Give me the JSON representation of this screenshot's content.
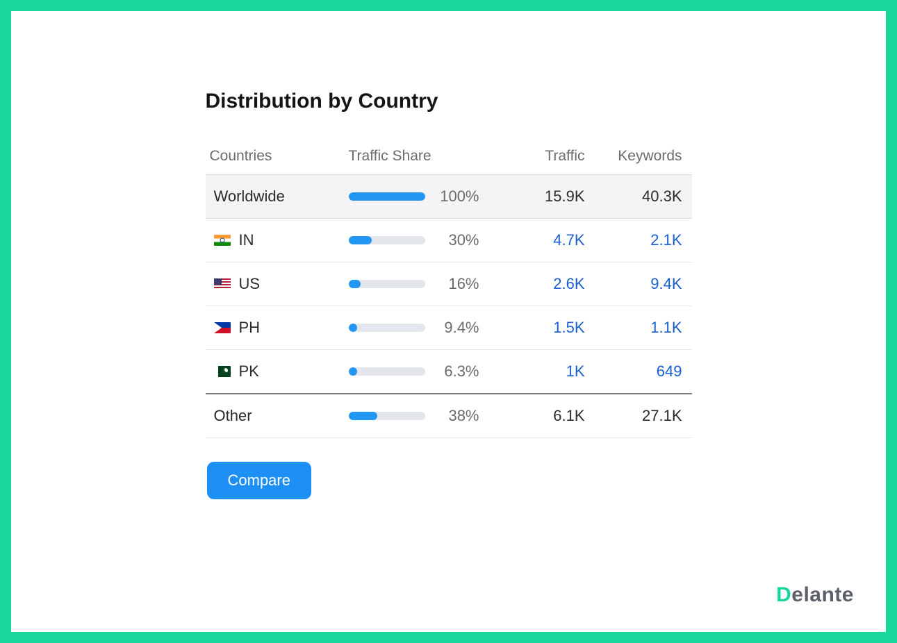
{
  "title": "Distribution by Country",
  "headers": {
    "countries": "Countries",
    "share": "Traffic Share",
    "traffic": "Traffic",
    "keywords": "Keywords"
  },
  "rows": [
    {
      "kind": "worldwide",
      "label": "Worldwide",
      "flag": "",
      "share_pct": "100%",
      "share_val": 100,
      "traffic": "15.9K",
      "keywords": "40.3K",
      "link": false
    },
    {
      "kind": "country",
      "label": "IN",
      "flag": "in",
      "share_pct": "30%",
      "share_val": 30,
      "traffic": "4.7K",
      "keywords": "2.1K",
      "link": true
    },
    {
      "kind": "country",
      "label": "US",
      "flag": "us",
      "share_pct": "16%",
      "share_val": 16,
      "traffic": "2.6K",
      "keywords": "9.4K",
      "link": true
    },
    {
      "kind": "country",
      "label": "PH",
      "flag": "ph",
      "share_pct": "9.4%",
      "share_val": 9.4,
      "traffic": "1.5K",
      "keywords": "1.1K",
      "link": true
    },
    {
      "kind": "country",
      "label": "PK",
      "flag": "pk",
      "share_pct": "6.3%",
      "share_val": 6.3,
      "traffic": "1K",
      "keywords": "649",
      "link": true
    },
    {
      "kind": "other",
      "label": "Other",
      "flag": "",
      "share_pct": "38%",
      "share_val": 38,
      "traffic": "6.1K",
      "keywords": "27.1K",
      "link": false
    }
  ],
  "compare_label": "Compare",
  "brand": {
    "d": "D",
    "rest": "elante"
  },
  "chart_data": {
    "type": "table",
    "title": "Distribution by Country",
    "columns": [
      "Country",
      "Traffic Share (%)",
      "Traffic",
      "Keywords"
    ],
    "rows": [
      [
        "Worldwide",
        100,
        "15.9K",
        "40.3K"
      ],
      [
        "IN",
        30,
        "4.7K",
        "2.1K"
      ],
      [
        "US",
        16,
        "2.6K",
        "9.4K"
      ],
      [
        "PH",
        9.4,
        "1.5K",
        "1.1K"
      ],
      [
        "PK",
        6.3,
        "1K",
        "649"
      ],
      [
        "Other",
        38,
        "6.1K",
        "27.1K"
      ]
    ]
  }
}
